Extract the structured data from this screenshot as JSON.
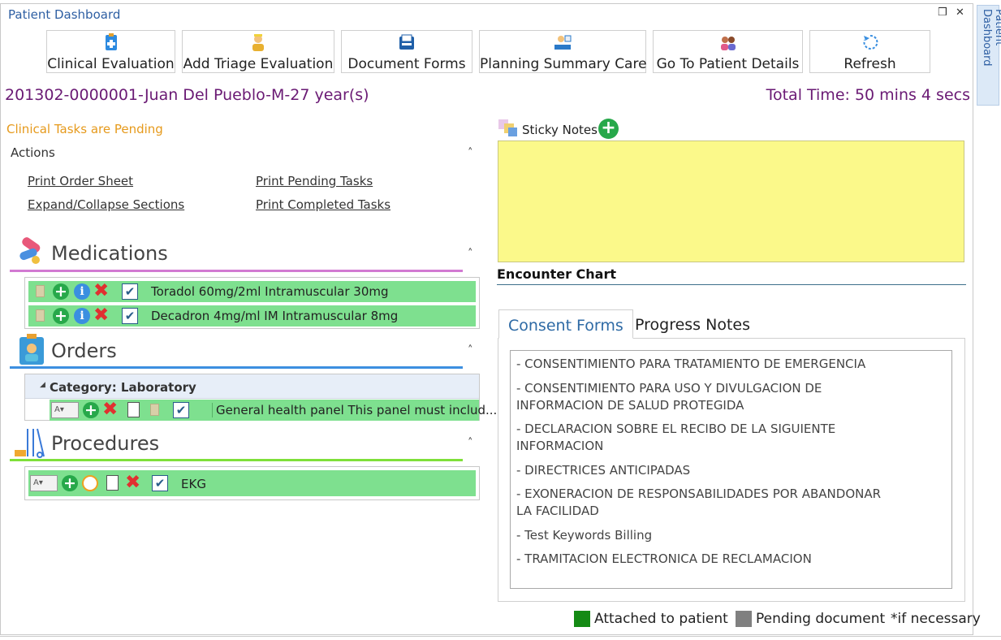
{
  "window": {
    "title": "Patient Dashboard",
    "pin_glyph": "❒",
    "close_glyph": "✕",
    "side_tab_label": "Patient Dashboard"
  },
  "toolbar": {
    "buttons": [
      {
        "label": "Clinical Evaluation",
        "icon": "clipboard-icon"
      },
      {
        "label": "Add Triage Evaluation",
        "icon": "nurse-icon"
      },
      {
        "label": "Document Forms",
        "icon": "file-tray-icon"
      },
      {
        "label": "Planning Summary Care",
        "icon": "doctor-desk-icon"
      },
      {
        "label": "Go To Patient Details",
        "icon": "patients-icon"
      },
      {
        "label": "Refresh",
        "icon": "refresh-icon"
      }
    ]
  },
  "patient": {
    "id": "201302-0000001",
    "name": "Juan Del Pueblo",
    "sex": "M",
    "age": "27 year(s)",
    "sep": "-",
    "total_time": "Total Time: 50 mins 4 secs"
  },
  "tasks": {
    "pending_message": "Clinical Tasks are Pending",
    "actions_label": "Actions",
    "links": [
      "Print Order Sheet",
      "Print Pending Tasks",
      "Expand/Collapse Sections",
      "Print Completed Tasks"
    ]
  },
  "medications": {
    "title": "Medications",
    "items": [
      {
        "text": "Toradol 60mg/2ml  Intramuscular  30mg"
      },
      {
        "text": "Decadron 4mg/ml IM  Intramuscular  8mg"
      }
    ]
  },
  "orders": {
    "title": "Orders",
    "category": "Category: Laboratory",
    "items": [
      {
        "text": "General health panel This panel must includ..."
      }
    ]
  },
  "procedures": {
    "title": "Procedures",
    "items": [
      {
        "text": "EKG"
      }
    ]
  },
  "glyphs": {
    "plus": "+",
    "info": "i",
    "x": "✖",
    "check": "✔",
    "chevron_up": "˄",
    "drop": "A▾",
    "triangle": "◢"
  },
  "sticky": {
    "title": "Sticky Notes",
    "add_glyph": "+"
  },
  "encounter": {
    "title": "Encounter Chart",
    "tabs": [
      "Consent Forms",
      "Progress Notes"
    ],
    "consent_forms": [
      "- CONSENTIMIENTO PARA TRATAMIENTO DE EMERGENCIA",
      "- CONSENTIMIENTO PARA USO Y DIVULGACION DE INFORMACION DE SALUD PROTEGIDA",
      "- DECLARACION SOBRE EL RECIBO DE LA SIGUIENTE INFORMACION",
      "- DIRECTRICES ANTICIPADAS",
      "- EXONERACION DE RESPONSABILIDADES POR ABANDONAR LA FACILIDAD",
      "- Test Keywords Billing",
      "- TRAMITACION ELECTRONICA DE RECLAMACION"
    ]
  },
  "legend": {
    "attached": {
      "label": "Attached to patient",
      "color": "#148a14"
    },
    "pending": {
      "label": "Pending document",
      "color": "#808080"
    },
    "note": "*if necessary"
  },
  "colors": {
    "accent": "#2e5fa3",
    "patient": "#6a1a74",
    "pending": "#e69a1c",
    "row": "#7ee08f",
    "sticky": "#fbf98a",
    "med_line": "#d27ad2",
    "orders_line": "#3d8fe0",
    "proc_line": "#7fe03a"
  }
}
